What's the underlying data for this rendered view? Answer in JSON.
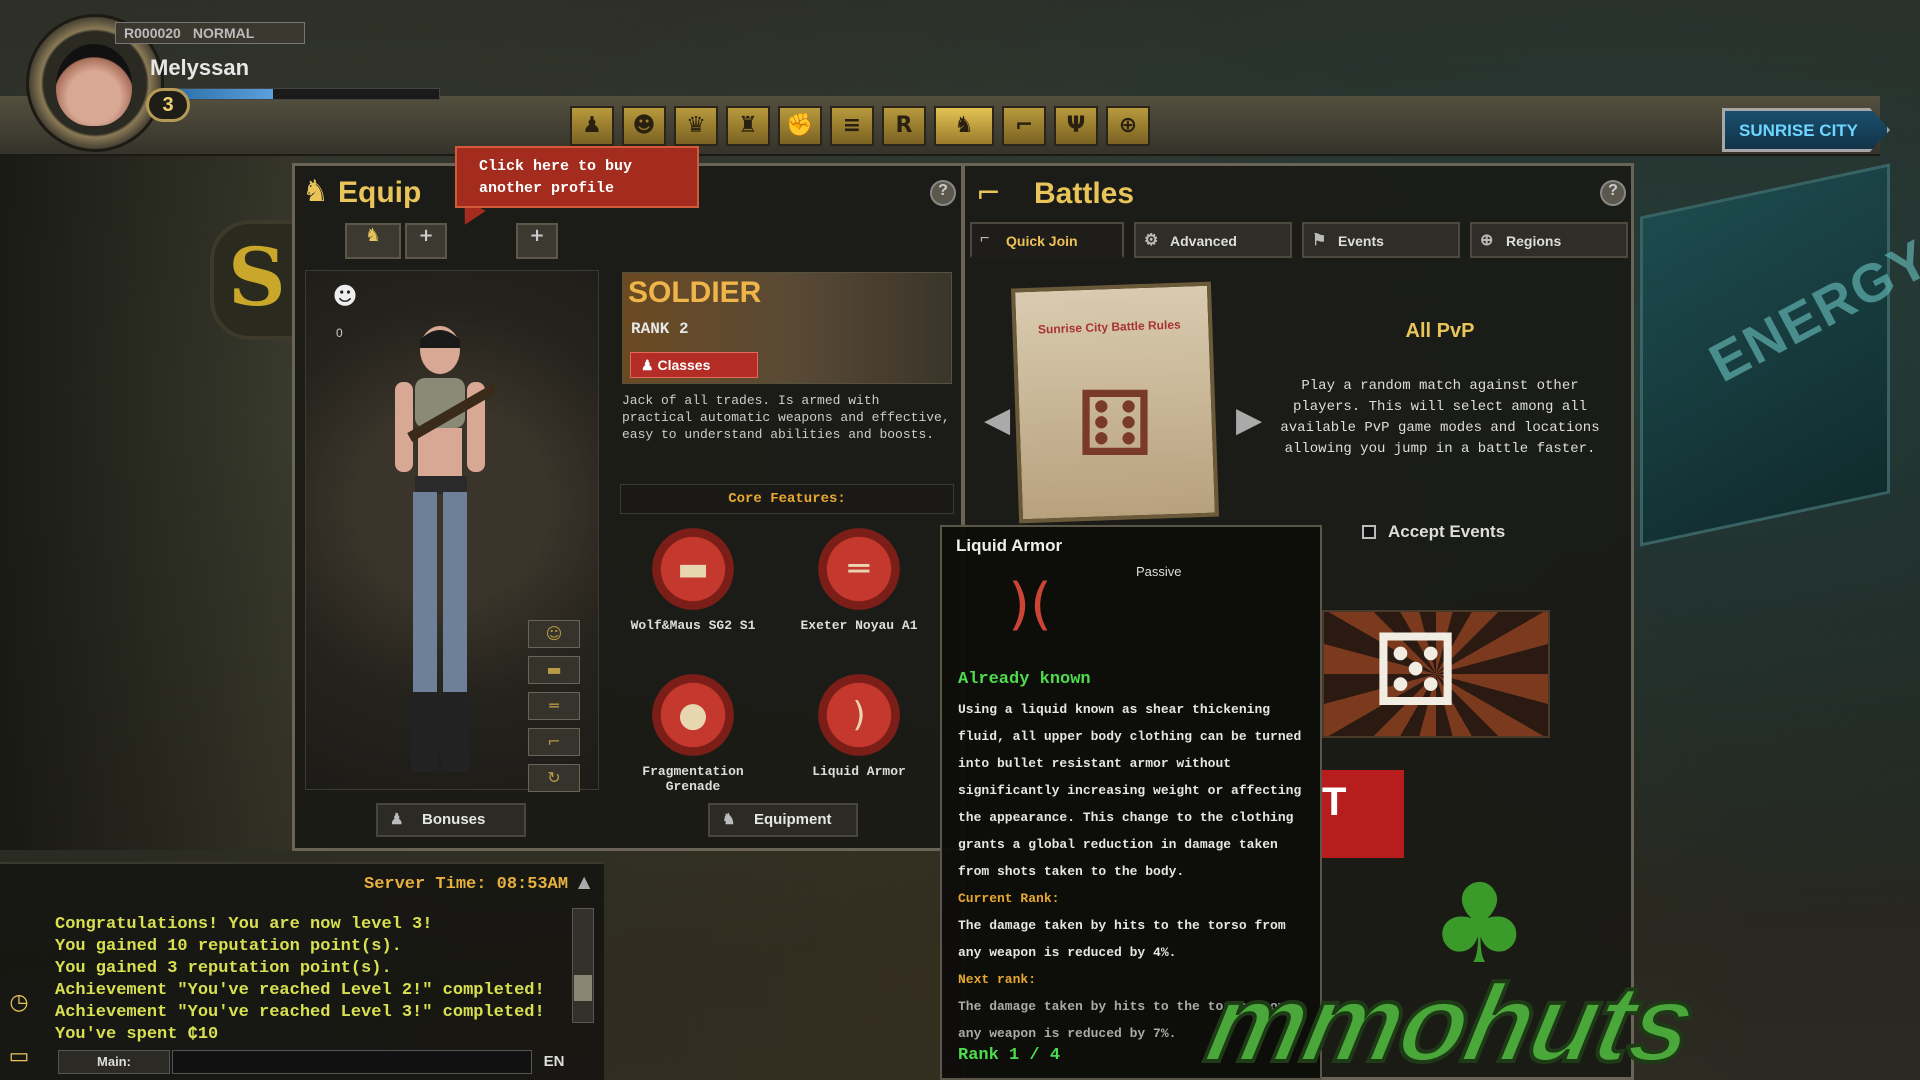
{
  "player": {
    "id_prefix": "R",
    "id_number": "000020",
    "mode": "NORMAL",
    "name": "Melyssan",
    "level": "3",
    "xp_fraction": 0.38
  },
  "top_nav": {
    "icons": [
      "profile-icon",
      "character-icon",
      "trophy-icon",
      "friends-icon",
      "fist-icon",
      "ranking-icon",
      "r-icon",
      "equip-icon",
      "gun-icon",
      "clan-icon",
      "globe-icon"
    ],
    "active_index": 7
  },
  "location": {
    "city": "SUNRISE CITY"
  },
  "equip": {
    "title": "Equip",
    "callout": "Click here to buy another profile",
    "drop_count": "0",
    "class": {
      "name": "SOLDIER",
      "rank": "RANK 2",
      "classes_button": "Classes",
      "description": "Jack of all trades. Is armed with practical automatic weapons and effective, easy to understand abilities and boosts."
    },
    "core_features_label": "Core Features:",
    "features": [
      {
        "label": "Wolf&Maus SG2 S1",
        "icon": "rifle-icon"
      },
      {
        "label": "Exeter Noyau A1",
        "icon": "smg-icon"
      },
      {
        "label": "Fragmentation Grenade",
        "icon": "grenade-icon"
      },
      {
        "label": "Liquid Armor",
        "icon": "armor-icon"
      }
    ],
    "bonuses_button": "Bonuses",
    "equipment_button": "Equipment"
  },
  "battles": {
    "title": "Battles",
    "tabs": [
      "Quick Join",
      "Advanced",
      "Events",
      "Regions"
    ],
    "active_tab": 0,
    "card_title": "Sunrise City Battle Rules",
    "mode_title": "All PvP",
    "mode_description": "Play a random match against other players. This will select among all available PvP game modes and locations allowing you jump in a battle faster.",
    "accept_events": "Accept Events",
    "join_label": "T"
  },
  "skill_tooltip": {
    "title": "Liquid Armor",
    "type": "Passive",
    "status": "Already known",
    "description": "Using a liquid known as shear thickening fluid, all upper body clothing can be turned into bullet resistant armor without significantly increasing weight or affecting the appearance. This change to the clothing grants a global reduction in damage taken from shots taken to the body.",
    "current_rank_label": "Current Rank:",
    "current_rank_text": "The damage taken by hits to the torso from any weapon is reduced by 4%.",
    "next_rank_label": "Next rank:",
    "next_rank_text": "The damage taken by hits to the torso from any weapon is reduced by 7%.",
    "rank": "Rank 1 / 4"
  },
  "chat": {
    "server_time": "Server Time: 08:53AM",
    "lines": [
      "Congratulations! You are now level 3!",
      "You gained 10 reputation point(s).",
      "You gained 3 reputation point(s).",
      "Achievement \"You've reached Level 2!\" completed!",
      "Achievement \"You've reached Level 3!\" completed!",
      "You've spent ₵10"
    ],
    "channel": "Main:",
    "language": "EN"
  },
  "watermark": "mmohuts"
}
